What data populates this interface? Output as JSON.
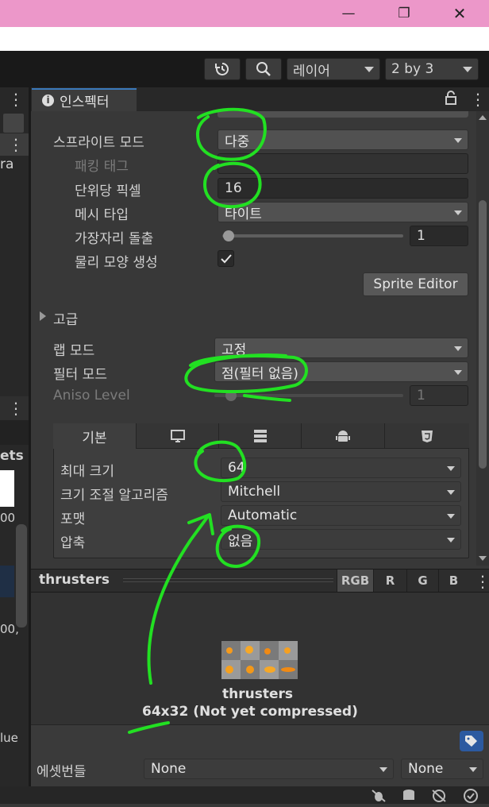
{
  "window": {
    "minimize": "—",
    "restore": "❐",
    "close": "✕"
  },
  "toolbar": {
    "layer_label": "레이어",
    "layout_label": "2 by 3"
  },
  "inspector": {
    "tab_title": "인스펙터",
    "fields": {
      "sprite_mode_label": "스프라이트 모드",
      "sprite_mode_value": "다중",
      "packing_tag_label": "패킹 태그",
      "packing_tag_value": "",
      "ppu_label": "단위당 픽셀",
      "ppu_value": "16",
      "mesh_type_label": "메시 타입",
      "mesh_type_value": "타이트",
      "extrude_label": "가장자리 돌출",
      "extrude_value": "1",
      "physics_shape_label": "물리 모양 생성",
      "physics_shape_checked": true,
      "sprite_editor_label": "Sprite Editor",
      "advanced_label": "고급",
      "wrap_mode_label": "랩 모드",
      "wrap_mode_value": "고정",
      "filter_mode_label": "필터 모드",
      "filter_mode_value": "점(필터 없음)",
      "aniso_label": "Aniso Level",
      "aniso_value": "1"
    },
    "platform": {
      "tab_default": "기본",
      "max_size_label": "최대 크기",
      "max_size_value": "64",
      "resize_label": "크기 조절 알고리즘",
      "resize_value": "Mitchell",
      "format_label": "포맷",
      "format_value": "Automatic",
      "compression_label": "압축",
      "compression_value": "없음"
    }
  },
  "preview": {
    "title": "thrusters",
    "channels": [
      "RGB",
      "R",
      "G",
      "B"
    ],
    "asset_name": "thrusters",
    "asset_info": "64x32 (Not yet compressed)"
  },
  "bundle": {
    "label": "에셋번들",
    "name_value": "None",
    "variant_value": "None"
  },
  "left_fragments": {
    "ra": "ra",
    "ets": "ets",
    "n00": "00",
    "n00b": "00,",
    "lue": "lue"
  },
  "colors": {
    "annotation": "#22e022",
    "title_bar": "#ec97c9",
    "tab_accent": "#3a79bb"
  }
}
